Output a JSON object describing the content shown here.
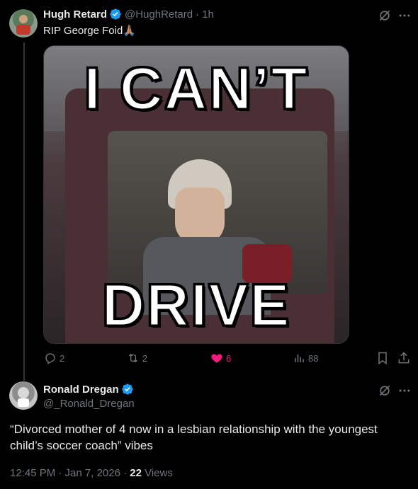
{
  "tweet1": {
    "author_name": "Hugh Retard",
    "handle": "@HughRetard",
    "sep": "·",
    "time": "1h",
    "text": "RIP George Foid🙏🏽",
    "media_top_text": "I CAN’T",
    "media_bottom_text": "DRIVE",
    "stats": {
      "replies": "2",
      "reposts": "2",
      "likes": "6",
      "views": "88"
    },
    "like_color": "#f91880"
  },
  "tweet2": {
    "author_name": "Ronald Dregan",
    "handle": "@_Ronald_Dregan",
    "text": "“Divorced mother of 4 now in a lesbian relationship with the youngest child’s soccer coach” vibes",
    "time": "12:45 PM · Jan 7, 2026 · ",
    "views_count": "22",
    "views_label": " Views"
  },
  "colors": {
    "verified": "#1d9bf0",
    "muted": "#71767b"
  }
}
